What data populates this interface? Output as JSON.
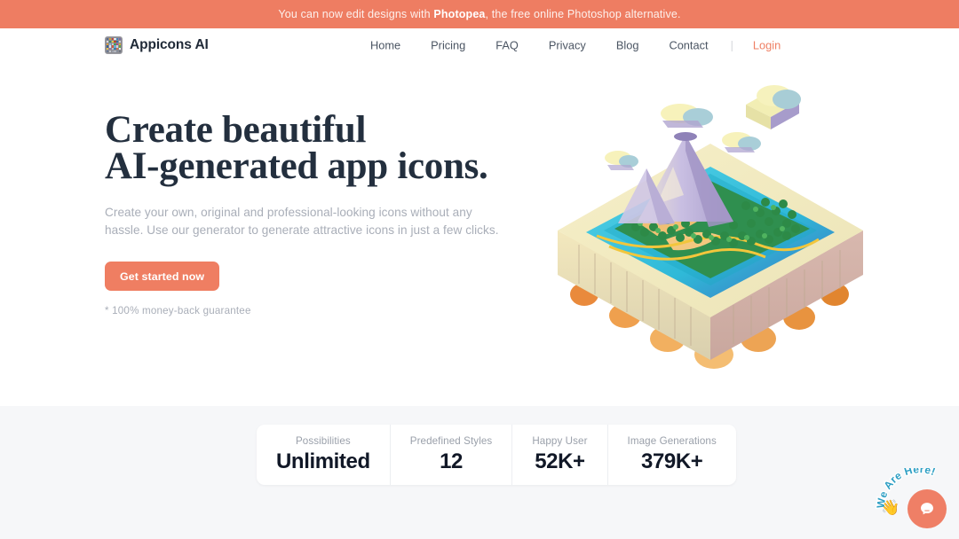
{
  "promo": {
    "prefix": "You can now edit designs with ",
    "brand": "Photopea",
    "suffix": ", the free online Photoshop alternative."
  },
  "header": {
    "logo_icon": "appicons-grid-icon",
    "logo_text": "Appicons AI",
    "nav": [
      {
        "label": "Home"
      },
      {
        "label": "Pricing"
      },
      {
        "label": "FAQ"
      },
      {
        "label": "Privacy"
      },
      {
        "label": "Blog"
      },
      {
        "label": "Contact"
      }
    ],
    "separator": "|",
    "login_label": "Login"
  },
  "hero": {
    "title_line1": "Create beautiful",
    "title_line2": "AI-generated app icons.",
    "subtitle": "Create your own, original and professional-looking icons without any hassle. Use our generator to generate attractive icons in just a few clicks.",
    "cta_label": "Get started now",
    "guarantee": "* 100% money-back guarantee",
    "illustration": "isometric-volcano-island-illustration"
  },
  "stats": [
    {
      "label": "Possibilities",
      "value": "Unlimited"
    },
    {
      "label": "Predefined Styles",
      "value": "12"
    },
    {
      "label": "Happy User",
      "value": "52K+"
    },
    {
      "label": "Image Generations",
      "value": "379K+"
    }
  ],
  "chat": {
    "arc_text": "We Are Here!",
    "hand_icon": "waving-hand-icon",
    "button_icon": "chat-bubble-icon"
  },
  "colors": {
    "accent": "#ef7f63",
    "banner": "#ee7d62",
    "heading": "#232f3e",
    "muted_text": "#a9aeb8",
    "stats_bg": "#f6f7f9",
    "arc_text": "#2e9fc4"
  }
}
